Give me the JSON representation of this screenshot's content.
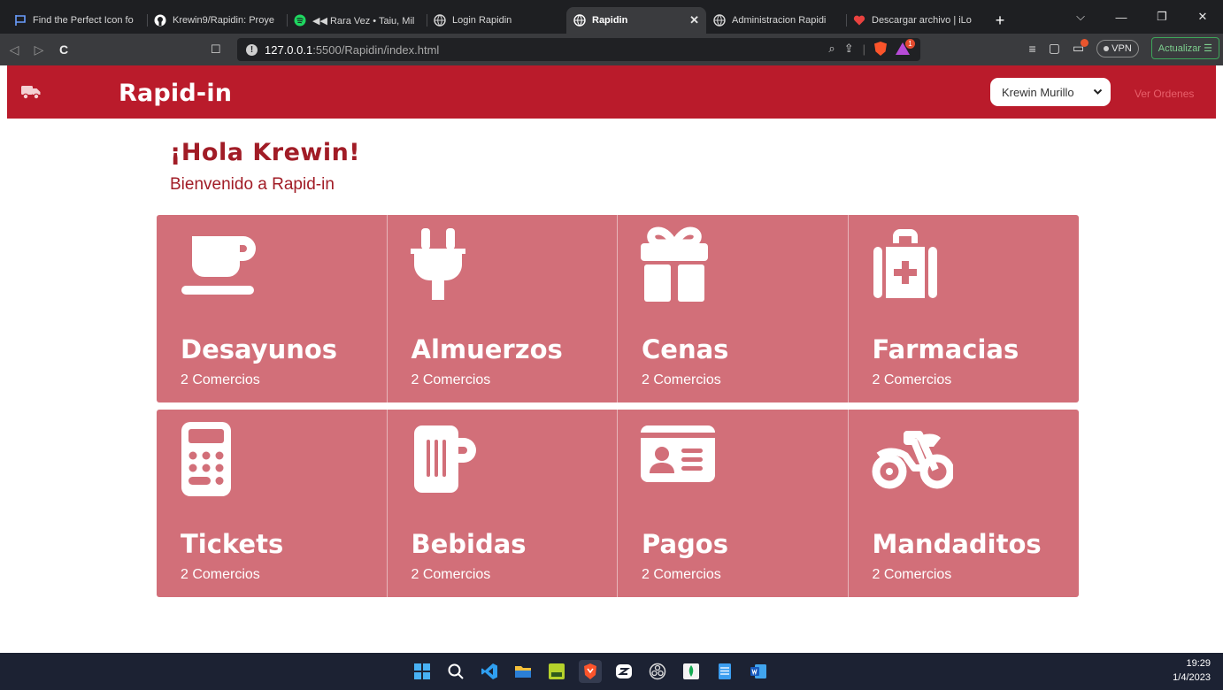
{
  "browser": {
    "tabs": [
      {
        "title": "Find the Perfect Icon fo",
        "icon": "flag-icon",
        "active": false
      },
      {
        "title": "Krewin9/Rapidin: Proye",
        "icon": "github-icon",
        "active": false
      },
      {
        "title": "◀◀ Rara Vez • Taiu, Mil",
        "icon": "spotify-icon",
        "active": false
      },
      {
        "title": "Login Rapidin",
        "icon": "globe-icon",
        "active": false
      },
      {
        "title": "Rapidin",
        "icon": "globe-icon",
        "active": true
      },
      {
        "title": "Administracion Rapidi",
        "icon": "globe-icon",
        "active": false
      },
      {
        "title": "Descargar archivo | iLo",
        "icon": "heart-icon",
        "active": false
      }
    ],
    "url_host": "127.0.0.1",
    "url_rest": ":5500/Rapidin/index.html",
    "vpn_label": "VPN",
    "update_label": "Actualizar"
  },
  "app": {
    "brand": "Rapid-in",
    "user_selected": "Krewin Murillo",
    "orders_link": "Ver Ordenes",
    "greeting": "¡Hola Krewin!",
    "welcome": "Bienvenido a Rapid-in",
    "accent_color": "#ba1b2b",
    "card_color": "#d26f79"
  },
  "categories": [
    {
      "name": "Desayunos",
      "count": "2 Comercios",
      "icon": "coffee-cup-icon"
    },
    {
      "name": "Almuerzos",
      "count": "2 Comercios",
      "icon": "plug-icon"
    },
    {
      "name": "Cenas",
      "count": "2 Comercios",
      "icon": "gift-icon"
    },
    {
      "name": "Farmacias",
      "count": "2 Comercios",
      "icon": "medical-kit-icon"
    },
    {
      "name": "Tickets",
      "count": "2 Comercios",
      "icon": "calculator-icon"
    },
    {
      "name": "Bebidas",
      "count": "2 Comercios",
      "icon": "beer-mug-icon"
    },
    {
      "name": "Pagos",
      "count": "2 Comercios",
      "icon": "id-card-icon"
    },
    {
      "name": "Mandaditos",
      "count": "2 Comercios",
      "icon": "motorcycle-icon"
    }
  ],
  "taskbar": {
    "time": "19:29",
    "date": "1/4/2023"
  }
}
